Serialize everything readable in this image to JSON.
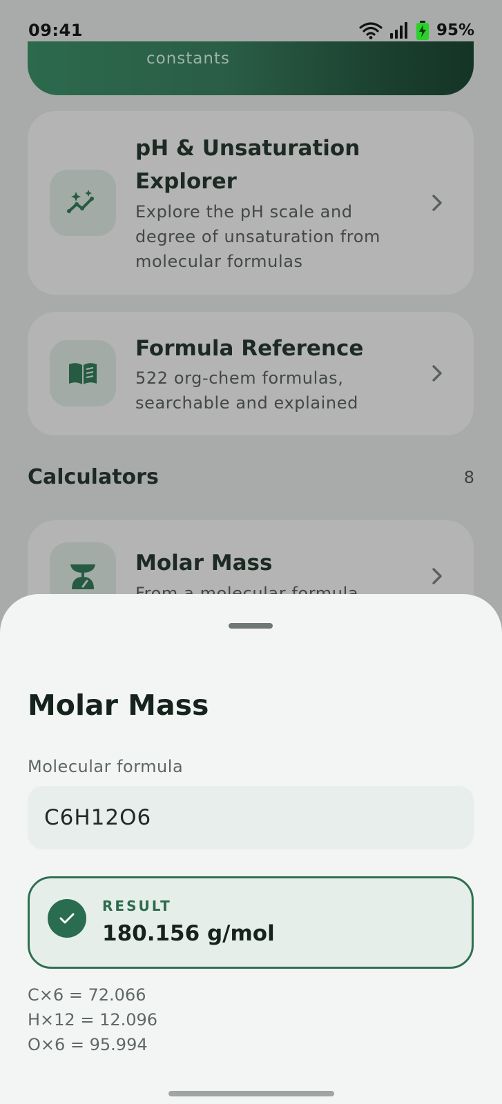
{
  "status_bar": {
    "time": "09:41",
    "battery": "95%",
    "icons": [
      "wifi-icon",
      "signal-icon",
      "battery-charging-icon"
    ]
  },
  "hero": {
    "subtitle": "constants"
  },
  "cards": [
    {
      "title_line1": "pH & Unsaturation",
      "title_line2": "Explorer",
      "desc_line1": "Explore the pH scale and",
      "desc_line2": "degree of unsaturation from",
      "desc_line3": "molecular formulas",
      "icon": "sparkle-chart-icon"
    },
    {
      "title": "Formula Reference",
      "desc_line1": "522 org-chem formulas,",
      "desc_line2": "searchable and explained",
      "icon": "open-book-icon"
    }
  ],
  "calculators_section": {
    "title": "Calculators",
    "count": "8",
    "items": [
      {
        "title": "Molar Mass",
        "desc": "From a molecular formula",
        "icon": "scale-icon"
      }
    ]
  },
  "sheet": {
    "title": "Molar Mass",
    "field_label": "Molecular formula",
    "formula_value": "C6H12O6",
    "result_label": "RESULT",
    "result_value": "180.156 g/mol",
    "breakdown": [
      "C×6 = 72.066",
      "H×12 = 12.096",
      "O×6 = 95.994"
    ]
  },
  "colors": {
    "accent": "#2a6c4f",
    "sheet_background": "#f3f5f4",
    "scrim": "#a9abaa"
  }
}
